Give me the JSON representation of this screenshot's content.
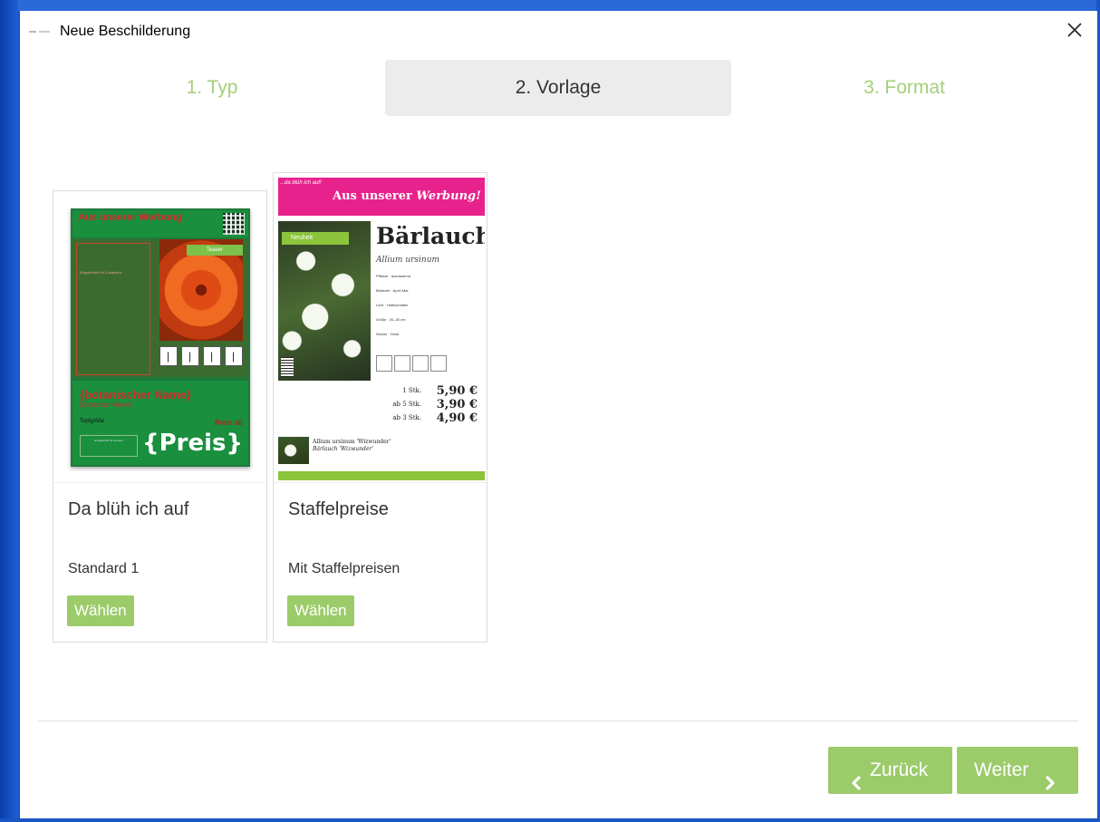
{
  "window": {
    "title": "Neue Beschilderung"
  },
  "steps": [
    {
      "label": "1. Typ"
    },
    {
      "label": "2. Vorlage"
    },
    {
      "label": "3. Format"
    }
  ],
  "templates": [
    {
      "name": "Da blüh ich auf",
      "description": "Standard 1",
      "choose_label": "Wählen",
      "preview": {
        "header": "Aus unserer Werbung",
        "tag": "Teaser",
        "left_text": "Eingabefeld für Zusatztext",
        "botanical": "{botanischer Name}",
        "common": "{Deutscher Name}",
        "small": "Topfgröße",
        "old_price": "Preis alt",
        "box_text": "Eingabefeld für Hinweis",
        "price": "{Preis}"
      }
    },
    {
      "name": "Staffelpreise",
      "description": "Mit Staffelpreisen",
      "choose_label": "Wählen",
      "preview": {
        "logo": "...da blüh ich auf!",
        "banner_prefix": "Aus unserer",
        "banner_em": "Werbung!",
        "badge": "Neuheit",
        "plant": "Bärlauch",
        "latin": "Allium ursinum",
        "info1": "Pflanze · ausdauernd",
        "info2": "Blütezeit · April–Mai",
        "info3": "Licht · Halbschatten",
        "info4": "Größe · 20–30 cm",
        "info5": "Wuchs · Horst",
        "prices": [
          {
            "label": "1 Stk.",
            "value": "5,90 €"
          },
          {
            "label": "ab 5 Stk.",
            "value": "3,90 €"
          },
          {
            "label": "ab 3 Stk.",
            "value": "4,90 €"
          }
        ],
        "variant_name": "Allium ursinum 'Wizwunder'",
        "variant_common": "Bärlauch 'Wizwunder'"
      }
    }
  ],
  "footer": {
    "back_label": "Zurück",
    "next_label": "Weiter"
  },
  "colors": {
    "accent": "#9ccb6a",
    "step_inactive": "#a5cf7a",
    "step_active_bg": "#ececec"
  }
}
